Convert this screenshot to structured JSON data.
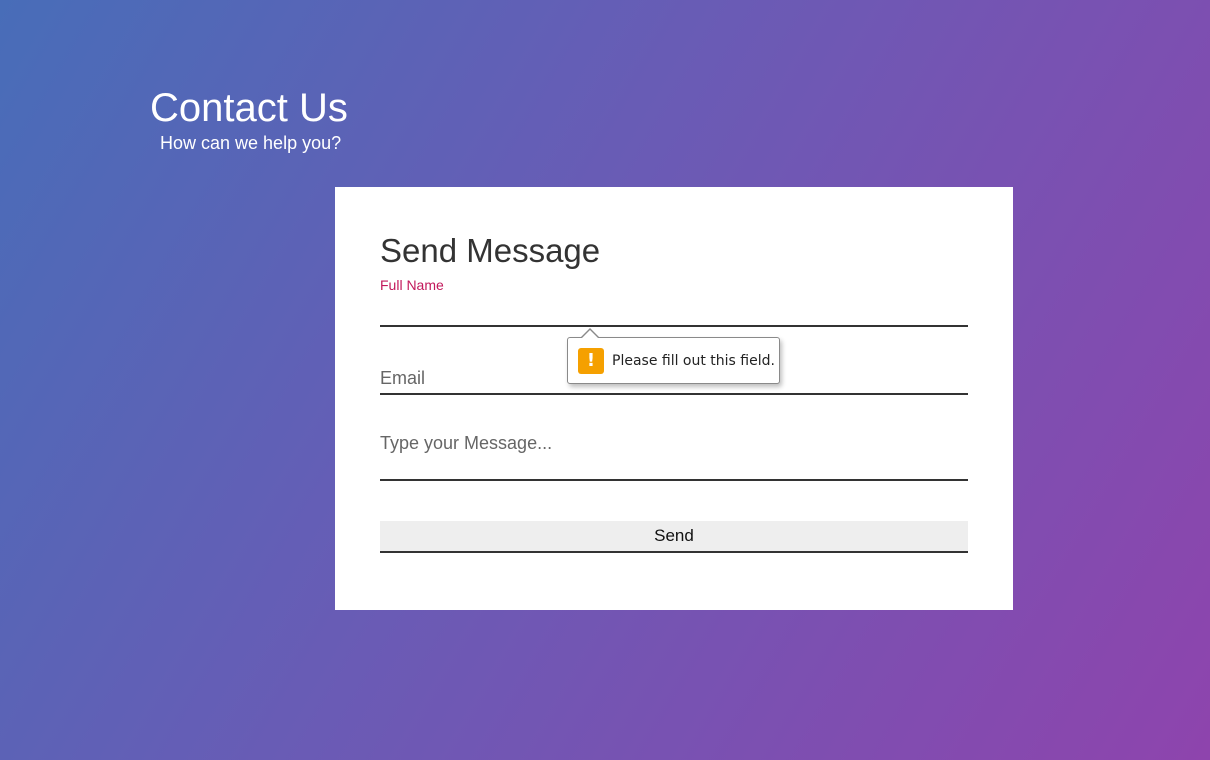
{
  "header": {
    "title": "Contact Us",
    "subtitle": "How can we help you?"
  },
  "form": {
    "title": "Send Message",
    "full_name": {
      "label": "Full Name",
      "value": ""
    },
    "email": {
      "placeholder": "Email",
      "value": ""
    },
    "message": {
      "placeholder": "Type your Message...",
      "value": ""
    },
    "send_label": "Send"
  },
  "validation_tooltip": {
    "icon": "warning-icon",
    "text": "Please fill out this field."
  },
  "colors": {
    "gradient_start": "#486db8",
    "gradient_end": "#8e44ad",
    "label_active": "#c2185b",
    "warning": "#f5a000"
  }
}
